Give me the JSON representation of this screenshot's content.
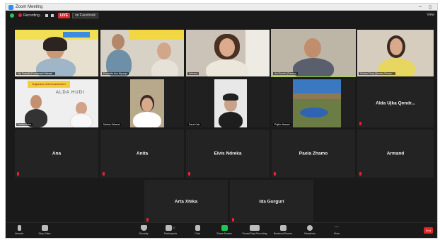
{
  "window": {
    "title": "Zoom Meeting",
    "minimize": "–",
    "maximize": "▯"
  },
  "topbar": {
    "recording_label": "Recording...",
    "live_label": "LIVE",
    "facebook_label": "on Facebook",
    "view_label": "View"
  },
  "tiles": [
    {
      "name": "Ida Frakulli (Fondacioni Hekzat...",
      "kind": "video",
      "bg": "#e9e2d2"
    },
    {
      "name": "Erveletta Ana Myrzeja",
      "kind": "video",
      "bg": "#d8d2c8"
    },
    {
      "name": "Arbnora",
      "kind": "video",
      "bg": "#cfc8bf"
    },
    {
      "name": "Ard Bardhi (Gazeta)",
      "kind": "video",
      "bg": "#c9c3b5",
      "active": true
    },
    {
      "name": "Xhulsa Cinaj (Qendra Rinore...",
      "kind": "video",
      "bg": "#d8d0c4"
    },
    {
      "name": "Ferida Bahe",
      "kind": "video",
      "bg": "#efefef",
      "banner": "Organizo #etermuzikmen",
      "subtext": "ALDA HUDI"
    },
    {
      "name": "Mirsha Zeherai",
      "kind": "video",
      "bg": "#b9a98a"
    },
    {
      "name": "Sara Kole",
      "kind": "video",
      "bg": "#e9e9e9"
    },
    {
      "name": "Pajtim Hasani",
      "kind": "video",
      "bg": "#3a6fb0"
    },
    {
      "name": "Alda Ujka Qendr...",
      "kind": "name"
    },
    {
      "name": "Ana",
      "kind": "name"
    },
    {
      "name": "Anita",
      "kind": "name"
    },
    {
      "name": "Elvis Ndreka",
      "kind": "name"
    },
    {
      "name": "Paola Zhamo",
      "kind": "name"
    },
    {
      "name": "Armand",
      "kind": "name"
    },
    {
      "name": "Arta Xhika",
      "kind": "name"
    },
    {
      "name": "Ida Gurguri",
      "kind": "name"
    }
  ],
  "toolbar": {
    "unmute": "Unmute",
    "stop_video": "Stop Video",
    "security": "Security",
    "participants": "Participants",
    "participants_count": "17",
    "chat": "Chat",
    "share_screen": "Share Screen",
    "pause_recording": "Pause/Stop Recording",
    "breakout_rooms": "Breakout Rooms",
    "reactions": "Reactions",
    "more": "More",
    "end": "End"
  },
  "colors": {
    "accent_green": "#23c552",
    "record_red": "#e02828",
    "active_speaker": "#9ae23b"
  }
}
